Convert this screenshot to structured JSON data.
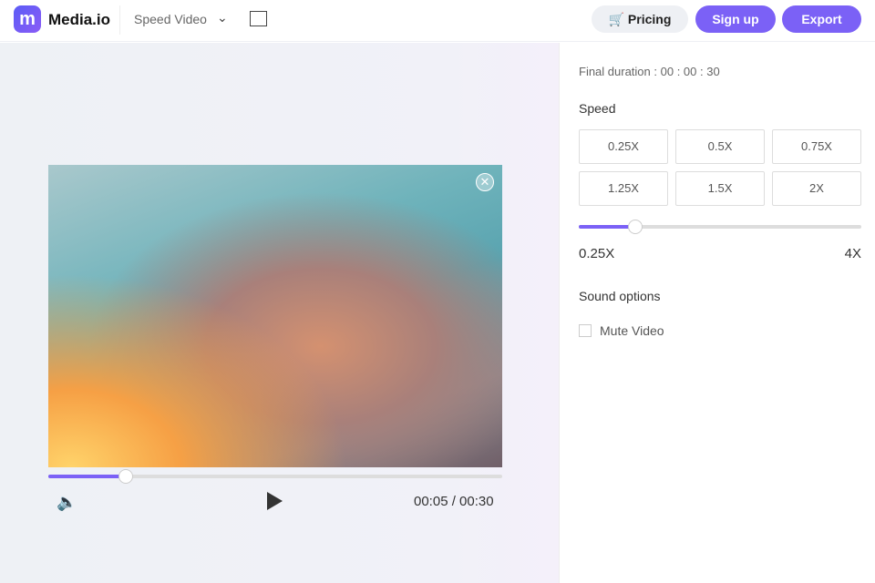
{
  "header": {
    "logo_letter": "m",
    "brand": "Media.io",
    "tool": "Speed Video",
    "pricing": "Pricing",
    "signup": "Sign up",
    "export": "Export"
  },
  "player": {
    "time": "00:05 / 00:30",
    "progress": 0.17
  },
  "panel": {
    "final_duration_label": "Final duration :",
    "final_duration": "00 : 00 : 30",
    "speed_label": "Speed",
    "speeds": [
      "0.25X",
      "0.5X",
      "0.75X",
      "1.25X",
      "1.5X",
      "2X"
    ],
    "slider_min": "0.25X",
    "slider_max": "4X",
    "slider_fraction": 0.2,
    "sound_label": "Sound options",
    "mute_label": "Mute Video",
    "mute_checked": false
  },
  "colors": {
    "accent": "#7b61f6"
  }
}
